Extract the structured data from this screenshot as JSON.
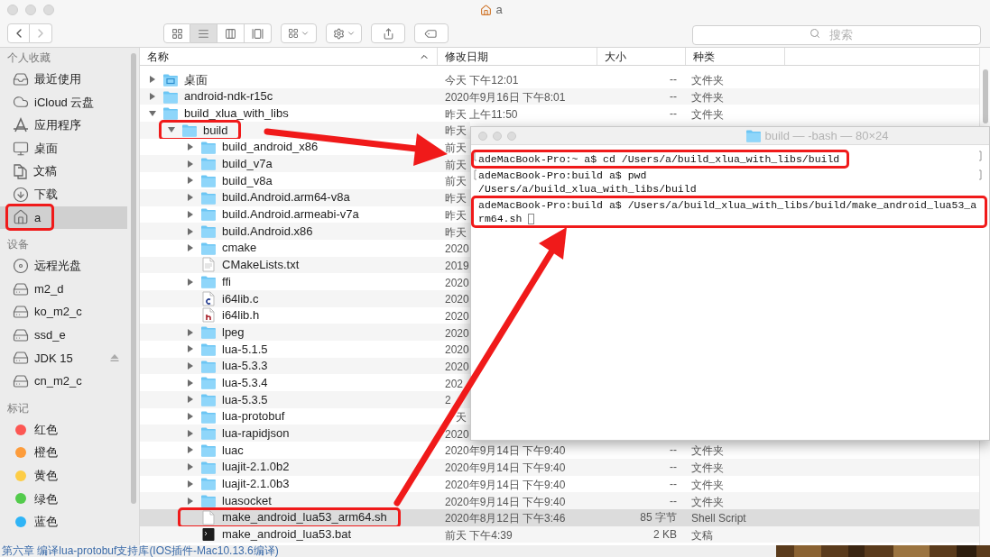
{
  "window": {
    "title": "a"
  },
  "toolbar": {
    "view_modes": [
      {
        "kind": "icons",
        "selected": false
      },
      {
        "kind": "list",
        "selected": true
      },
      {
        "kind": "columns",
        "selected": false
      },
      {
        "kind": "gallery",
        "selected": false
      }
    ],
    "search": {
      "placeholder": "搜索"
    }
  },
  "sidebar": {
    "sections": [
      {
        "title": "个人收藏",
        "items": [
          {
            "kind": "recents",
            "label": "最近使用",
            "selected": false,
            "highlighted": false
          },
          {
            "kind": "cloud",
            "label": "iCloud 云盘",
            "selected": false,
            "highlighted": false
          },
          {
            "kind": "apps",
            "label": "应用程序",
            "selected": false,
            "highlighted": false
          },
          {
            "kind": "desktop",
            "label": "桌面",
            "selected": false,
            "highlighted": false
          },
          {
            "kind": "documents",
            "label": "文稿",
            "selected": false,
            "highlighted": false
          },
          {
            "kind": "downloads",
            "label": "下载",
            "selected": false,
            "highlighted": false
          },
          {
            "kind": "home",
            "label": "a",
            "selected": true,
            "highlighted": true
          }
        ]
      },
      {
        "title": "设备",
        "items": [
          {
            "kind": "disc",
            "label": "远程光盘",
            "selected": false,
            "highlighted": false
          },
          {
            "kind": "drive",
            "label": "m2_d",
            "selected": false,
            "highlighted": false
          },
          {
            "kind": "drive",
            "label": "ko_m2_c",
            "selected": false,
            "highlighted": false
          },
          {
            "kind": "drive",
            "label": "ssd_e",
            "selected": false,
            "highlighted": false
          },
          {
            "kind": "volume",
            "label": "JDK 15",
            "selected": false,
            "highlighted": false,
            "ejectable": true
          },
          {
            "kind": "drive",
            "label": "cn_m2_c",
            "selected": false,
            "highlighted": false
          }
        ]
      },
      {
        "title": "标记",
        "items": [
          {
            "kind": "tag",
            "label": "红色",
            "color": "#fc5753",
            "selected": false,
            "highlighted": false
          },
          {
            "kind": "tag",
            "label": "橙色",
            "color": "#fd9c3b",
            "selected": false,
            "highlighted": false
          },
          {
            "kind": "tag",
            "label": "黄色",
            "color": "#fdcd46",
            "selected": false,
            "highlighted": false
          },
          {
            "kind": "tag",
            "label": "绿色",
            "color": "#53cb4c",
            "selected": false,
            "highlighted": false
          },
          {
            "kind": "tag",
            "label": "蓝色",
            "color": "#2fb4f6",
            "selected": false,
            "highlighted": false
          }
        ]
      }
    ]
  },
  "file_list": {
    "columns": [
      "名称",
      "修改日期",
      "大小",
      "种类"
    ],
    "rows": [
      {
        "kind": "desktop-folder",
        "name": "桌面",
        "date": "今天 下午12:01",
        "size": "--",
        "type": "文件夹",
        "expanded": false,
        "selected": false,
        "highlighted": false
      },
      {
        "kind": "folder",
        "name": "android-ndk-r15c",
        "date": "2020年9月16日 下午8:01",
        "size": "--",
        "type": "文件夹",
        "expanded": false,
        "selected": false,
        "highlighted": false
      },
      {
        "kind": "folder",
        "name": "build_xlua_with_libs",
        "date": "昨天 上午11:50",
        "size": "--",
        "type": "文件夹",
        "expanded": true,
        "selected": false,
        "highlighted": false,
        "children": [
          {
            "kind": "folder",
            "name": "build",
            "date": "昨天",
            "expanded": true,
            "selected": false,
            "highlighted": true,
            "children": [
              {
                "kind": "folder",
                "name": "build_android_x86",
                "date": "前天",
                "expanded": false,
                "selected": false,
                "highlighted": false
              },
              {
                "kind": "folder",
                "name": "build_v7a",
                "date": "前天",
                "expanded": false,
                "selected": false,
                "highlighted": false
              },
              {
                "kind": "folder",
                "name": "build_v8a",
                "date": "前天",
                "expanded": false,
                "selected": false,
                "highlighted": false
              },
              {
                "kind": "folder",
                "name": "build.Android.arm64-v8a",
                "date": "昨天",
                "expanded": false,
                "selected": false,
                "highlighted": false
              },
              {
                "kind": "folder",
                "name": "build.Android.armeabi-v7a",
                "date": "昨天",
                "expanded": false,
                "selected": false,
                "highlighted": false
              },
              {
                "kind": "folder",
                "name": "build.Android.x86",
                "date": "昨天",
                "expanded": false,
                "selected": false,
                "highlighted": false
              },
              {
                "kind": "folder",
                "name": "cmake",
                "date": "2020",
                "expanded": false,
                "selected": false,
                "highlighted": false
              },
              {
                "kind": "text-file",
                "name": "CMakeLists.txt",
                "date": "2019",
                "selected": false,
                "highlighted": false
              },
              {
                "kind": "folder",
                "name": "ffi",
                "date": "2020",
                "expanded": false,
                "selected": false,
                "highlighted": false
              },
              {
                "kind": "c-file",
                "name": "i64lib.c",
                "date": "2020",
                "selected": false,
                "highlighted": false
              },
              {
                "kind": "h-file",
                "name": "i64lib.h",
                "date": "2020",
                "selected": false,
                "highlighted": false
              },
              {
                "kind": "folder",
                "name": "lpeg",
                "date": "2020",
                "expanded": false,
                "selected": false,
                "highlighted": false
              },
              {
                "kind": "folder",
                "name": "lua-5.1.5",
                "date": "2020",
                "expanded": false,
                "selected": false,
                "highlighted": false
              },
              {
                "kind": "folder",
                "name": "lua-5.3.3",
                "date": "2020",
                "expanded": false,
                "selected": false,
                "highlighted": false
              },
              {
                "kind": "folder",
                "name": "lua-5.3.4",
                "date": "202",
                "expanded": false,
                "selected": false,
                "highlighted": false
              },
              {
                "kind": "folder",
                "name": "lua-5.3.5",
                "date": "2",
                "expanded": false,
                "selected": false,
                "highlighted": false
              },
              {
                "kind": "folder",
                "name": "lua-protobuf",
                "date": "天",
                "date_offset": true,
                "expanded": false,
                "selected": false,
                "highlighted": false
              },
              {
                "kind": "folder",
                "name": "lua-rapidjson",
                "date": "2020",
                "expanded": false,
                "selected": false,
                "highlighted": false
              },
              {
                "kind": "folder",
                "name": "luac",
                "date": "2020年9月14日 下午9:40",
                "size": "--",
                "type": "文件夹",
                "expanded": false,
                "selected": false,
                "highlighted": false
              },
              {
                "kind": "folder",
                "name": "luajit-2.1.0b2",
                "date": "2020年9月14日 下午9:40",
                "size": "--",
                "type": "文件夹",
                "expanded": false,
                "selected": false,
                "highlighted": false
              },
              {
                "kind": "folder",
                "name": "luajit-2.1.0b3",
                "date": "2020年9月14日 下午9:40",
                "size": "--",
                "type": "文件夹",
                "expanded": false,
                "selected": false,
                "highlighted": false
              },
              {
                "kind": "folder",
                "name": "luasocket",
                "date": "2020年9月14日 下午9:40",
                "size": "--",
                "type": "文件夹",
                "expanded": false,
                "selected": false,
                "highlighted": false
              },
              {
                "kind": "script-file",
                "name": "make_android_lua53_arm64.sh",
                "date": "2020年8月12日 下午3:46",
                "size": "85 字节",
                "type": "Shell Script",
                "selected": true,
                "highlighted": true
              },
              {
                "kind": "terminal-file",
                "name": "make_android_lua53.bat",
                "date": "前天 下午4:39",
                "size": "2 KB",
                "type": "文稿",
                "selected": false,
                "highlighted": false
              }
            ]
          }
        ]
      }
    ]
  },
  "terminal": {
    "title": "build — -bash — 80×24",
    "lines": [
      {
        "text": "adeMacBook-Pro:~ a$ cd /Users/a/build_xlua_with_libs/build",
        "marked": true,
        "highlighted": true,
        "cursor": false
      },
      {
        "text": "adeMacBook-Pro:build a$ pwd",
        "marked": true,
        "highlighted": false,
        "cursor": false
      },
      {
        "text": "/Users/a/build_xlua_with_libs/build",
        "marked": false,
        "highlighted": false,
        "cursor": false
      },
      {
        "text": "adeMacBook-Pro:build a$ /Users/a/build_xlua_with_libs/build/make_android_lua53_arm64.sh",
        "marked": false,
        "highlighted": true,
        "cursor": true
      }
    ]
  },
  "background_page": {
    "heading": "第六章 编译lua-protobuf支持库(IOS插件-Mac10.13.6编译)"
  }
}
